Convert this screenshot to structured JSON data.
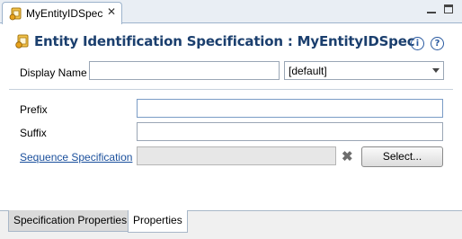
{
  "tab": {
    "title": "MyEntityIDSpec",
    "close_symbol": "✕"
  },
  "header": {
    "title": "Entity Identification Specification : MyEntityIDSpec",
    "info_symbol": "i",
    "help_symbol": "?"
  },
  "display_name": {
    "label": "Display Name",
    "value": "",
    "locale_value": "[default]"
  },
  "fields": {
    "prefix": {
      "label": "Prefix",
      "value": ""
    },
    "suffix": {
      "label": "Suffix",
      "value": ""
    },
    "sequence": {
      "label": "Sequence Specification",
      "value": "",
      "clear_symbol": "✖",
      "select_label": "Select..."
    }
  },
  "bottom_tabs": [
    {
      "label": "Specification Properties",
      "active": false
    },
    {
      "label": "Properties",
      "active": true
    }
  ],
  "colors": {
    "title": "#1b3f6e",
    "link": "#1a4f9c",
    "accent": "#e8a21c"
  },
  "icons": [
    "entity-spec-icon",
    "minimize-icon",
    "maximize-icon",
    "info-icon",
    "help-icon",
    "clear-icon",
    "dropdown-arrow-icon"
  ]
}
